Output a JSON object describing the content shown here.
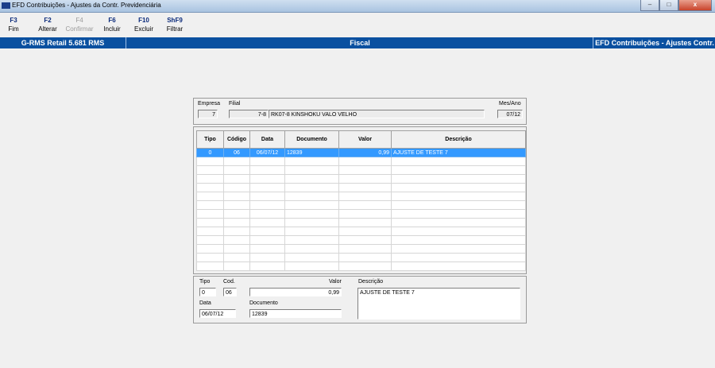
{
  "window": {
    "title": "EFD Contribuições - Ajustes da Contr. Previdenciária",
    "minimize": "–",
    "maximize": "□",
    "close": "x"
  },
  "toolbar": [
    {
      "key": "F3",
      "label": "Fim",
      "enabled": true
    },
    {
      "key": "F2",
      "label": "Alterar",
      "enabled": true
    },
    {
      "key": "F4",
      "label": "Confirmar",
      "enabled": false
    },
    {
      "key": "F6",
      "label": "Incluir",
      "enabled": true
    },
    {
      "key": "F10",
      "label": "Excluir",
      "enabled": true
    },
    {
      "key": "ShF9",
      "label": "Filtrar",
      "enabled": true
    }
  ],
  "status": {
    "app": "G-RMS Retail 5.681 RMS",
    "module": "Fiscal",
    "screen": "EFD Contribuições - Ajustes Contr."
  },
  "header": {
    "empresa_label": "Empresa",
    "empresa": "7",
    "filial_label": "Filial",
    "filial_code": "7-8",
    "filial_name": "RK07-8 KINSHOKU VALO VELHO",
    "mesano_label": "Mes/Ano",
    "mesano": "07/12"
  },
  "grid": {
    "columns": [
      "Tipo",
      "Código",
      "Data",
      "Documento",
      "Valor",
      "Descrição"
    ],
    "rows": [
      [
        "0",
        "06",
        "06/07/12",
        "12839",
        "0,99",
        "AJUSTE DE TESTE 7"
      ]
    ],
    "empty_rows": 13,
    "selected_row_color": "#3399ff"
  },
  "detail": {
    "tipo_label": "Tipo",
    "tipo": "0",
    "cod_label": "Cod.",
    "cod": "06",
    "valor_label": "Valor",
    "valor": "0,99",
    "descricao_label": "Descrição",
    "descricao": "AJUSTE DE TESTE 7",
    "data_label": "Data",
    "data": "06/07/12",
    "documento_label": "Documento",
    "documento": "12839"
  }
}
